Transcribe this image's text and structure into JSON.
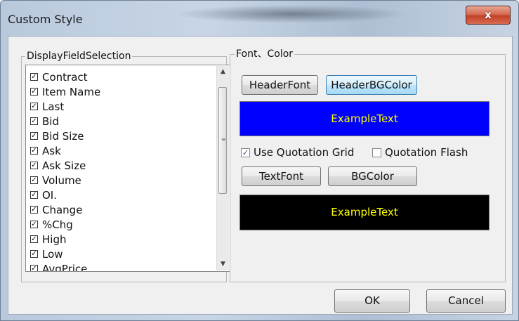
{
  "window": {
    "title": "Custom Style",
    "close_glyph": "x"
  },
  "display_fields": {
    "legend": "DisplayFieldSelection",
    "items": [
      {
        "label": "Contract",
        "checked": true
      },
      {
        "label": "Item Name",
        "checked": true
      },
      {
        "label": "Last",
        "checked": true
      },
      {
        "label": "Bid",
        "checked": true
      },
      {
        "label": "Bid Size",
        "checked": true
      },
      {
        "label": "Ask",
        "checked": true
      },
      {
        "label": "Ask Size",
        "checked": true
      },
      {
        "label": "Volume",
        "checked": true
      },
      {
        "label": "OI.",
        "checked": true
      },
      {
        "label": "Change",
        "checked": true
      },
      {
        "label": "%Chg",
        "checked": true
      },
      {
        "label": "High",
        "checked": true
      },
      {
        "label": "Low",
        "checked": true
      },
      {
        "label": "AvgPrice",
        "checked": true
      }
    ]
  },
  "font_color": {
    "legend": "Font、Color",
    "header_font_label": "HeaderFont",
    "header_bgcolor_label": "HeaderBGColor",
    "header_example": {
      "text": "ExampleText",
      "bg": "#0000ff",
      "fg": "#ffff00"
    },
    "use_quotation_grid": {
      "label": "Use Quotation Grid",
      "checked": true
    },
    "quotation_flash": {
      "label": "Quotation Flash",
      "checked": false
    },
    "text_font_label": "TextFont",
    "bgcolor_label": "BGColor",
    "text_example": {
      "text": "ExampleText",
      "bg": "#000000",
      "fg": "#ffff00"
    }
  },
  "footer": {
    "ok_label": "OK",
    "cancel_label": "Cancel"
  },
  "icons": {
    "check": "check-icon",
    "scroll_up": "arrow-up-icon",
    "scroll_down": "arrow-down-icon"
  }
}
